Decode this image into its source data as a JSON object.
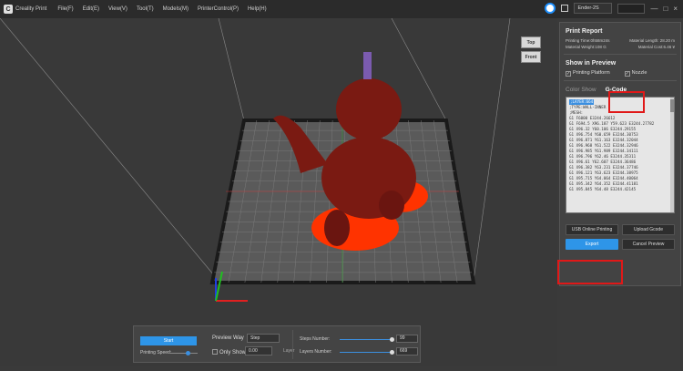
{
  "titlebar": {
    "app_name": "Creality Print",
    "logo_letter": "C",
    "menus": [
      "File(F)",
      "Edit(E)",
      "View(V)",
      "Tool(T)",
      "Models(M)",
      "PrinterControl(P)",
      "Help(H)"
    ],
    "printer": "Ender-2S",
    "minimize": "—",
    "maximize": "□",
    "close": "×"
  },
  "viewcube": {
    "top": "Top",
    "front": "Front"
  },
  "panel": {
    "title": "Print Report",
    "printing_time": "Printing Time:0h58m24s",
    "material_length": "Material Length: 28.20 m",
    "material_weight": "Material Weight:108 G",
    "material_cost": "Material Cost:6.46 ¥",
    "preview_title": "Show in Preview",
    "printing_platform": "Printing Platform",
    "nozzle": "Nozzle",
    "tab_color": "Color Show",
    "tab_gcode": "G-Code",
    "gcode_lines": [
      ";LAYER:664",
      ";TYPE:WALL-INNER",
      ";MESH:",
      "G1 F6000 E3244.26612",
      "G1 F694.5 X96.187 Y59.623 E3244.27782",
      "G1 X96.32 Y60.106 E3244.29155",
      "G1 X96.754 Y60.659 E3244.30753",
      "G1 X96.871 Y61.163 E3244.32044",
      "G1 X96.968 Y61.522 E3244.32946",
      "G1 X96.985 Y61.989 E3244.34111",
      "G1 X96.796 Y62.46 E3244.35311",
      "G1 X96.61 Y62.607 E3244.36486",
      "G1 X96.382 Y63.231 E3244.37746",
      "G1 X96.121 Y63.623 E3244.38975",
      "G1 X95.715 Y64.064 E3244.40064",
      "G1 X95.342 Y64.352 E3244.41181",
      "G1 X95.845 Y64.48 E3244.42145"
    ],
    "usb_print": "USB Online Printing",
    "upload_gcode": "Upload Gcode",
    "export": "Export",
    "cancel_preview": "Cancel Preview"
  },
  "bottom": {
    "start": "Start",
    "printing_speed": "Printing Speed:",
    "preview_way": "Preview Way",
    "preview_way_value": "Step",
    "only_show": "Only Show",
    "only_show_value": "0.00",
    "layer": "Layer",
    "steps_number": "Steps Number:",
    "steps_value": "99",
    "layers_number": "Layers Number:",
    "layers_value": "669"
  }
}
